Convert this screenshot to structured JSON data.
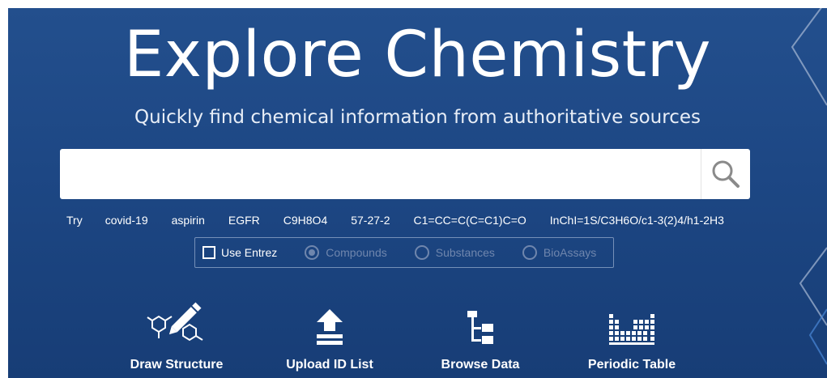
{
  "hero": {
    "title": "Explore Chemistry",
    "subtitle": "Quickly find chemical information from authoritative sources"
  },
  "search": {
    "value": "",
    "placeholder": "",
    "button_icon": "search-icon"
  },
  "try": {
    "label": "Try",
    "examples": [
      "covid-19",
      "aspirin",
      "EGFR",
      "C9H8O4",
      "57-27-2",
      "C1=CC=C(C=C1)C=O",
      "InChI=1S/C3H6O/c1-3(2)4/h1-2H3"
    ]
  },
  "options": {
    "use_entrez": "Use Entrez",
    "use_entrez_checked": false,
    "radios": [
      "Compounds",
      "Substances",
      "BioAssays"
    ],
    "selected_radio": "Compounds",
    "radios_disabled": true
  },
  "tools": [
    {
      "label": "Draw Structure",
      "icon": "draw-structure-icon"
    },
    {
      "label": "Upload ID List",
      "icon": "upload-icon"
    },
    {
      "label": "Browse Data",
      "icon": "tree-icon"
    },
    {
      "label": "Periodic Table",
      "icon": "periodic-table-icon"
    }
  ],
  "colors": {
    "background": "#1d4784",
    "text": "#ffffff",
    "disabled": "#6f86ad"
  }
}
